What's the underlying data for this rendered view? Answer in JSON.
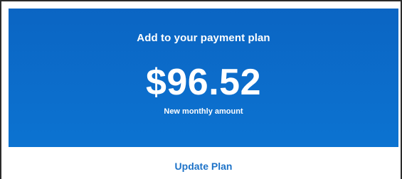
{
  "banner": {
    "title": "Add to your payment plan",
    "amount": "$96.52",
    "subtitle": "New monthly amount"
  },
  "footer": {
    "action_label": "Update Plan"
  },
  "colors": {
    "banner_background": "#0b6cc9",
    "link": "#1e73c8"
  }
}
